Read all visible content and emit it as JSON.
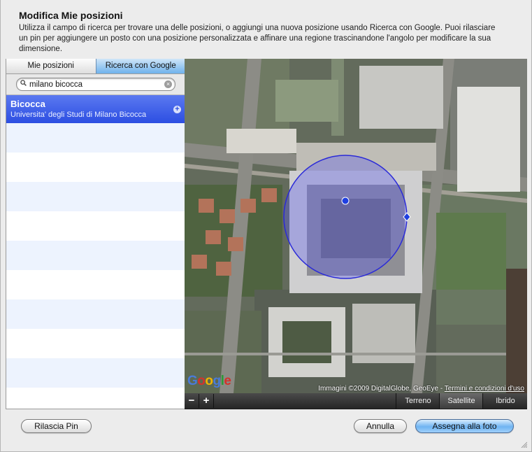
{
  "dialog": {
    "title": "Modifica Mie posizioni",
    "description": "Utilizza il campo di ricerca per trovare una delle posizioni, o aggiungi una nuova posizione usando Ricerca con Google. Puoi rilasciare un pin per aggiungere un posto con una posizione personalizzata e affinare una regione trascinandone l'angolo per modificare la sua dimensione."
  },
  "tabs": [
    {
      "label": "Mie posizioni",
      "active": false
    },
    {
      "label": "Ricerca con Google",
      "active": true
    }
  ],
  "search": {
    "value": "milano bicocca"
  },
  "results": [
    {
      "name": "Bicocca",
      "subtitle": "Universita' degli Studi di Milano Bicocca",
      "selected": true
    }
  ],
  "map": {
    "google_label": "Google",
    "copyright_text": "Immagini ©2009 DigitalGlobe, GeoEye - ",
    "terms_link": "Termini e condizioni d'uso",
    "zoom_out": "−",
    "zoom_in": "+",
    "types": [
      {
        "label": "Terreno",
        "active": false
      },
      {
        "label": "Satellite",
        "active": true
      },
      {
        "label": "Ibrido",
        "active": false
      }
    ],
    "region_color": "#2a2ad8"
  },
  "buttons": {
    "drop_pin": "Rilascia Pin",
    "cancel": "Annulla",
    "assign": "Assegna alla foto"
  },
  "colors": {
    "selection": "#3a5be8",
    "tab_active": "#8cc2f0",
    "primary_button": "#6fb4f2"
  }
}
